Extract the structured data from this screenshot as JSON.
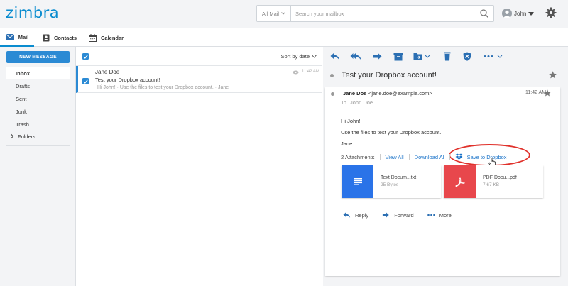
{
  "header": {
    "logo": "zimbra",
    "search_scope": "All Mail",
    "search_placeholder": "Search your mailbox",
    "user_name": "John"
  },
  "app_tabs": [
    {
      "label": "Mail"
    },
    {
      "label": "Contacts"
    },
    {
      "label": "Calendar"
    }
  ],
  "sidebar": {
    "new_message": "NEW MESSAGE",
    "folders": [
      {
        "label": "Inbox",
        "active": true
      },
      {
        "label": "Drafts"
      },
      {
        "label": "Sent"
      },
      {
        "label": "Junk"
      },
      {
        "label": "Trash"
      },
      {
        "label": "Folders"
      }
    ]
  },
  "message_list": {
    "sort_label": "Sort by date",
    "messages": [
      {
        "sender": "Jane Doe",
        "subject": "Test your Dropbox account!",
        "snippet": "Hi John! · Use the files to test your Dropbox account. · Jane",
        "time": "11:42 AM"
      }
    ]
  },
  "reader": {
    "subject": "Test your Dropbox account!",
    "from_name": "Jane Doe",
    "from_email": "<jane.doe@example.com>",
    "time": "11:42 AM",
    "to_label": "To",
    "to_name": "John Doe",
    "body": [
      "Hi John!",
      "Use the files to test your Dropbox account.",
      "Jane"
    ],
    "attachments_count": "2 Attachments",
    "view_all": "View All",
    "download_all": "Download All",
    "save_to_dropbox": "Save to Dropbox",
    "attachments": [
      {
        "name": "Text Docum...txt",
        "size": "25 Bytes"
      },
      {
        "name": "PDF Docu...pdf",
        "size": "7.67 KB"
      }
    ],
    "actions": {
      "reply": "Reply",
      "forward": "Forward",
      "more": "More"
    }
  },
  "colors": {
    "brand": "#0a8ccf",
    "primary_button": "#2b8ad4",
    "text_doc": "#2a73e8",
    "pdf_doc": "#e8474c",
    "highlight": "#e0312b"
  }
}
